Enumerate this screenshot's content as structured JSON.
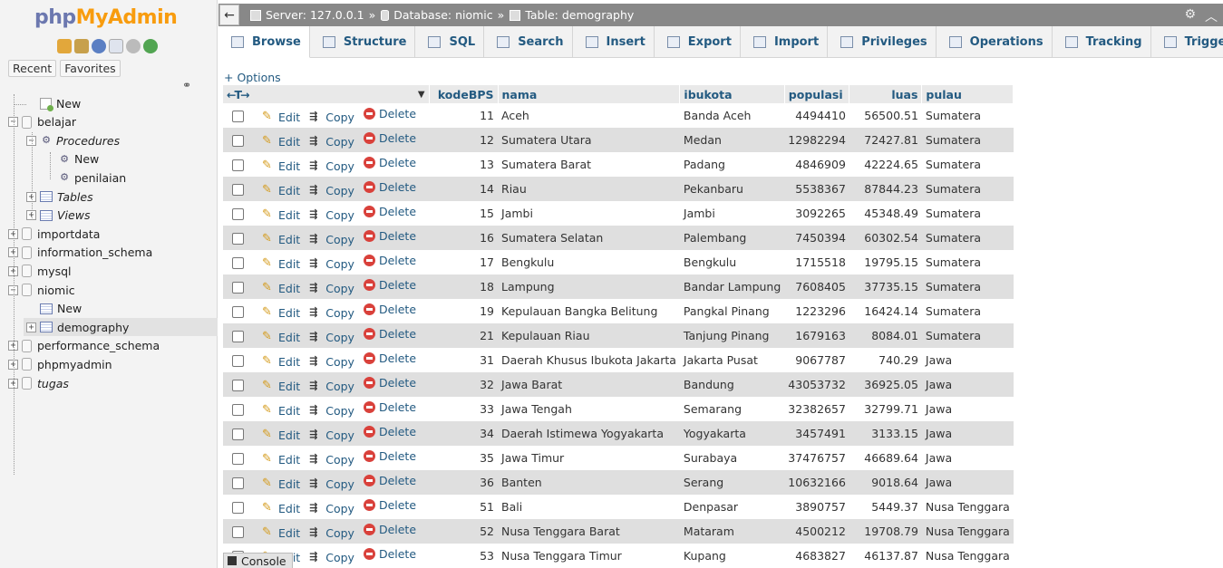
{
  "logo": {
    "part1": "php",
    "part2": "MyAdmin"
  },
  "nav": {
    "recent_label": "Recent",
    "favorites_label": "Favorites",
    "tree": [
      {
        "label": "New",
        "depth": 1,
        "kind": "new"
      },
      {
        "label": "belajar",
        "depth": 0,
        "kind": "db",
        "expander": "−"
      },
      {
        "label": "Procedures",
        "depth": 1,
        "kind": "proc",
        "expander": "−",
        "italic": true
      },
      {
        "label": "New",
        "depth": 2,
        "kind": "proc"
      },
      {
        "label": "penilaian",
        "depth": 2,
        "kind": "proc"
      },
      {
        "label": "Tables",
        "depth": 1,
        "kind": "tbl",
        "expander": "+",
        "italic": true
      },
      {
        "label": "Views",
        "depth": 1,
        "kind": "tbl",
        "expander": "+",
        "italic": true
      },
      {
        "label": "importdata",
        "depth": 0,
        "kind": "db",
        "expander": "+"
      },
      {
        "label": "information_schema",
        "depth": 0,
        "kind": "db",
        "expander": "+"
      },
      {
        "label": "mysql",
        "depth": 0,
        "kind": "db",
        "expander": "+"
      },
      {
        "label": "niomic",
        "depth": 0,
        "kind": "db",
        "expander": "−"
      },
      {
        "label": "New",
        "depth": 1,
        "kind": "newtbl"
      },
      {
        "label": "demography",
        "depth": 1,
        "kind": "tbl",
        "expander": "+",
        "selected": true
      },
      {
        "label": "performance_schema",
        "depth": 0,
        "kind": "db",
        "expander": "+"
      },
      {
        "label": "phpmyadmin",
        "depth": 0,
        "kind": "db",
        "expander": "+"
      },
      {
        "label": "tugas",
        "depth": 0,
        "kind": "db",
        "expander": "+",
        "italic": true
      }
    ]
  },
  "breadcrumb": {
    "server": "Server: 127.0.0.1",
    "sep": "»",
    "database": "Database: niomic",
    "table": "Table: demography"
  },
  "tabs": [
    "Browse",
    "Structure",
    "SQL",
    "Search",
    "Insert",
    "Export",
    "Import",
    "Privileges",
    "Operations",
    "Tracking",
    "Triggers"
  ],
  "options_label": "+ Options",
  "actions": {
    "edit": "Edit",
    "copy": "Copy",
    "delete": "Delete"
  },
  "columns": [
    "kodeBPS",
    "nama",
    "ibukota",
    "populasi",
    "luas",
    "pulau"
  ],
  "rows": [
    [
      "11",
      "Aceh",
      "Banda Aceh",
      "4494410",
      "56500.51",
      "Sumatera"
    ],
    [
      "12",
      "Sumatera Utara",
      "Medan",
      "12982294",
      "72427.81",
      "Sumatera"
    ],
    [
      "13",
      "Sumatera Barat",
      "Padang",
      "4846909",
      "42224.65",
      "Sumatera"
    ],
    [
      "14",
      "Riau",
      "Pekanbaru",
      "5538367",
      "87844.23",
      "Sumatera"
    ],
    [
      "15",
      "Jambi",
      "Jambi",
      "3092265",
      "45348.49",
      "Sumatera"
    ],
    [
      "16",
      "Sumatera Selatan",
      "Palembang",
      "7450394",
      "60302.54",
      "Sumatera"
    ],
    [
      "17",
      "Bengkulu",
      "Bengkulu",
      "1715518",
      "19795.15",
      "Sumatera"
    ],
    [
      "18",
      "Lampung",
      "Bandar Lampung",
      "7608405",
      "37735.15",
      "Sumatera"
    ],
    [
      "19",
      "Kepulauan Bangka Belitung",
      "Pangkal Pinang",
      "1223296",
      "16424.14",
      "Sumatera"
    ],
    [
      "21",
      "Kepulauan Riau",
      "Tanjung Pinang",
      "1679163",
      "8084.01",
      "Sumatera"
    ],
    [
      "31",
      "Daerah Khusus Ibukota Jakarta",
      "Jakarta Pusat",
      "9067787",
      "740.29",
      "Jawa"
    ],
    [
      "32",
      "Jawa Barat",
      "Bandung",
      "43053732",
      "36925.05",
      "Jawa"
    ],
    [
      "33",
      "Jawa Tengah",
      "Semarang",
      "32382657",
      "32799.71",
      "Jawa"
    ],
    [
      "34",
      "Daerah Istimewa Yogyakarta",
      "Yogyakarta",
      "3457491",
      "3133.15",
      "Jawa"
    ],
    [
      "35",
      "Jawa Timur",
      "Surabaya",
      "37476757",
      "46689.64",
      "Jawa"
    ],
    [
      "36",
      "Banten",
      "Serang",
      "10632166",
      "9018.64",
      "Jawa"
    ],
    [
      "51",
      "Bali",
      "Denpasar",
      "3890757",
      "5449.37",
      "Nusa Tenggara"
    ],
    [
      "52",
      "Nusa Tenggara Barat",
      "Mataram",
      "4500212",
      "19708.79",
      "Nusa Tenggara"
    ],
    [
      "53",
      "Nusa Tenggara Timur",
      "Kupang",
      "4683827",
      "46137.87",
      "Nusa Tenggara"
    ]
  ],
  "console_label": "Console"
}
